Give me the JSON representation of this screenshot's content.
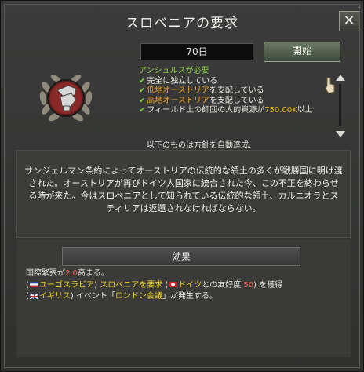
{
  "title": "スロベニアの要求",
  "close_label": "✕",
  "days": "70日",
  "start_label": "開始",
  "requirements": {
    "header": "アンシュルスが必要",
    "items": [
      {
        "pre": "完全に独立している",
        "hl": "",
        "post": ""
      },
      {
        "pre": "",
        "hl": "低地オーストリア",
        "post": "を支配している"
      },
      {
        "pre": "",
        "hl": "高地オーストリア",
        "post": "を支配している"
      },
      {
        "pre": "フィールド上の師団の人的資源が",
        "hl": "750.00K",
        "post": "以上"
      }
    ],
    "auto_label": "以下のものは方針を自動達成:"
  },
  "description": "サンジェルマン条約によってオーストリアの伝統的な領土の多くが戦勝国に明け渡された。オーストリアが再びドイツ人国家に統合された今、この不正を終わらせる時が来た。今はスロベニアとして知られている伝統的な領土、カルニオラとスティリアは返還されなければならない。",
  "effects_label": "効果",
  "effects": {
    "tension_pre": "国際緊張が",
    "tension_val": "2.0",
    "tension_post": "高まる。",
    "line2_country": "ユーゴスラビア",
    "line2_action": "スロベニアを要求",
    "line2_target": "ドイツ",
    "line2_mid": "との友好度",
    "line2_val": "50",
    "line2_post": ") を獲得",
    "line3_country": "イギリス",
    "line3_mid": "イベント「",
    "line3_event": "ロンドン会議",
    "line3_post": "」が発生する。"
  },
  "colors": {
    "accent_green": "#8ed04a",
    "highlight_orange": "#f0a020",
    "highlight_yellow": "#f0d020"
  }
}
